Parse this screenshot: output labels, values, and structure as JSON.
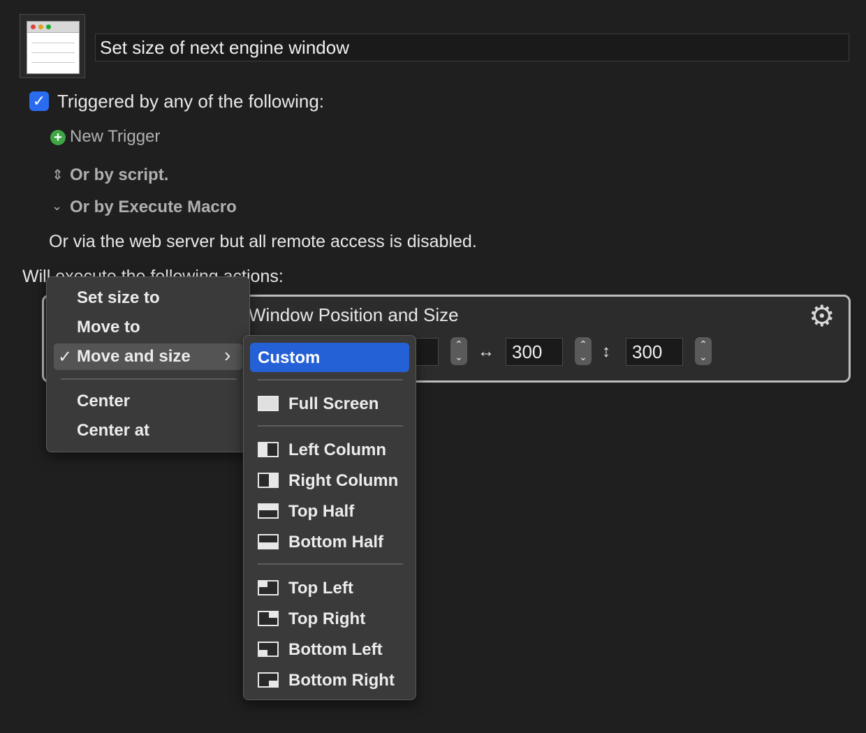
{
  "macro": {
    "title": "Set size of next engine window"
  },
  "triggers": {
    "heading": "Triggered by any of the following:",
    "new_trigger": "New Trigger",
    "by_script": "Or by script.",
    "by_execute_macro": "Or by Execute Macro",
    "web_server": "Or via the web server but all remote access is disabled."
  },
  "actions": {
    "heading": "Will execute the following actions:",
    "action_title": "Window Position and Size",
    "width_symbol": "↔",
    "height_symbol": "↕",
    "width_value": "300",
    "height_value": "300"
  },
  "main_menu": {
    "items": [
      {
        "label": "Set size to"
      },
      {
        "label": "Move to"
      },
      {
        "label": "Move and size",
        "checked": true,
        "submenu": true
      },
      {
        "label": "Center"
      },
      {
        "label": "Center at"
      }
    ],
    "check_mark": "✓",
    "submenu_arrow": "›"
  },
  "sub_menu": {
    "items": [
      {
        "label": "Custom",
        "selected": true
      },
      {
        "label": "Full Screen",
        "icon": "full-screen-icon"
      },
      {
        "label": "Left Column",
        "icon": "left-column-icon"
      },
      {
        "label": "Right Column",
        "icon": "right-column-icon"
      },
      {
        "label": "Top Half",
        "icon": "top-half-icon"
      },
      {
        "label": "Bottom Half",
        "icon": "bottom-half-icon"
      },
      {
        "label": "Top Left",
        "icon": "top-left-icon"
      },
      {
        "label": "Top Right",
        "icon": "top-right-icon"
      },
      {
        "label": "Bottom Left",
        "icon": "bottom-left-icon"
      },
      {
        "label": "Bottom Right",
        "icon": "bottom-right-icon"
      }
    ]
  },
  "colors": {
    "background": "#1f1f1f",
    "accent": "#2461d6",
    "checkbox": "#2a6cf0",
    "add_green": "#3fa646"
  }
}
